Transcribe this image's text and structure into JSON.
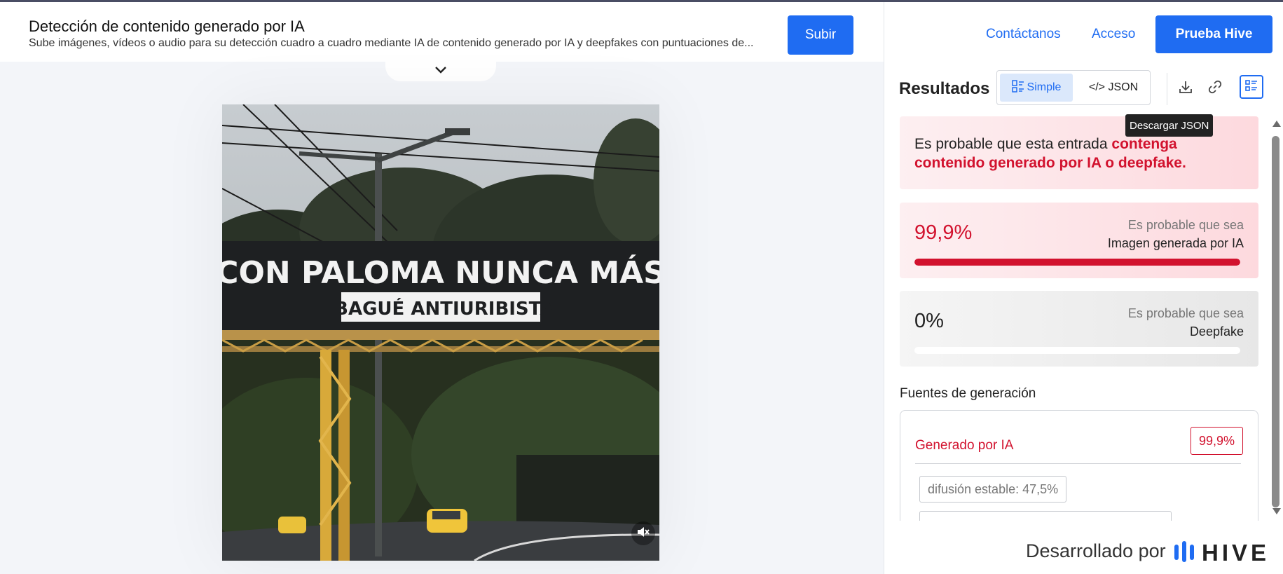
{
  "header": {
    "title": "Detección de contenido generado por IA",
    "subtitle": "Sube imágenes, vídeos o audio para su detección cuadro a cuadro mediante IA de contenido generado por IA y deepfakes con puntuaciones de...",
    "upload_label": "Subir"
  },
  "nav": {
    "contact": "Contáctanos",
    "login": "Acceso",
    "try_label": "Prueba Hive"
  },
  "preview": {
    "banner_line1": "CON PALOMA NUNCA MÁS",
    "banner_line2": "IBAGUÉ ANTIURIBISTA"
  },
  "results": {
    "title": "Resultados",
    "view_simple": "Simple",
    "view_json": "</> JSON",
    "tooltip": "Descargar JSON",
    "verdict_prefix": "Es probable que esta entrada",
    "verdict_strong": "contenga contenido generado por IA o deepfake.",
    "scores": [
      {
        "percent": "99,9%",
        "value": 0.999,
        "likely": "Es probable que sea",
        "label": "Imagen generada por IA"
      },
      {
        "percent": "0%",
        "value": 0.0,
        "likely": "Es probable que sea",
        "label": "Deepfake"
      }
    ],
    "sources_title": "Fuentes de generación",
    "source_label": "Generado por IA",
    "source_badge": "99,9%",
    "chips": [
      "difusión estable: 47,5%",
      ""
    ]
  },
  "footer": {
    "powered_by": "Desarrollado por",
    "brand": "HIVE"
  },
  "colors": {
    "accent": "#1f6cf2",
    "alert": "#d2122e"
  }
}
